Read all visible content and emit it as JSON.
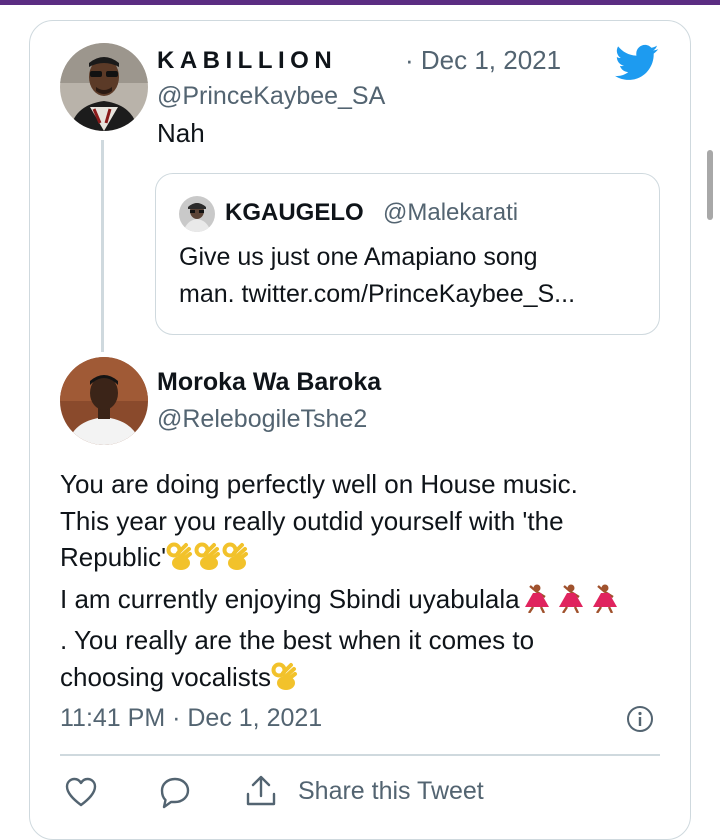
{
  "author": {
    "display_name": "KABILLION",
    "handle": "@PrinceKaybee_SA",
    "date": "· Dec 1, 2021"
  },
  "tweet_text": "Nah",
  "quoted": {
    "display_name": "KGAUGELO",
    "handle": "@Malekarati",
    "text_line1": "Give us just one Amapiano song",
    "text_line2": "man. twitter.com/PrinceKaybee_S..."
  },
  "reply": {
    "display_name": "Moroka Wa Baroka",
    "handle": "@RelebogileTshe2",
    "line1": "You are doing perfectly well on House music.",
    "line2": "This year you really outdid yourself with 'the",
    "line3": "Republic'",
    "line4": "I am currently enjoying Sbindi uyabulala",
    "line5": ". You really are the best when it comes to",
    "line6": "choosing vocalists",
    "timestamp": "11:41 PM · Dec 1, 2021"
  },
  "actions": {
    "share_label": "Share this Tweet"
  },
  "icons": [
    "twitter-bird-icon",
    "info-icon",
    "heart-icon",
    "reply-icon",
    "share-icon",
    "ok-hand-emoji",
    "dancer-emoji"
  ],
  "colors": {
    "accent": "#1d9bf0",
    "muted": "#536471",
    "border": "#cfd9de",
    "topbar": "#5b2d82"
  }
}
